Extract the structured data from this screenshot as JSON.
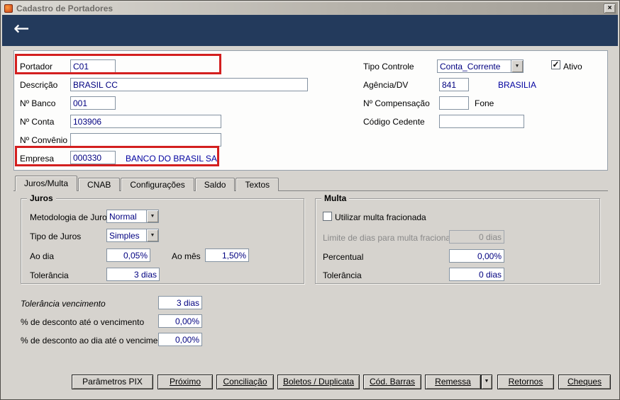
{
  "window": {
    "title": "Cadastro de Portadores",
    "close": "×"
  },
  "header": {
    "back_icon": "←"
  },
  "colors": {
    "header_bg": "#233a5c",
    "field_text": "#000080",
    "highlight_red": "#d31f1f",
    "info_blue": "#0000a0"
  },
  "form": {
    "portador": {
      "label": "Portador",
      "value": "C01"
    },
    "descricao": {
      "label": "Descrição",
      "value": "BRASIL CC"
    },
    "n_banco": {
      "label": "Nº Banco",
      "value": "001"
    },
    "n_conta": {
      "label": "Nº Conta",
      "value": "103906"
    },
    "n_convenio": {
      "label": "Nº Convênio",
      "value": ""
    },
    "empresa": {
      "label": "Empresa",
      "value": "000330",
      "descricao": "BANCO DO BRASIL SA"
    },
    "tipo_controle": {
      "label": "Tipo Controle",
      "value": "Conta_Corrente"
    },
    "ativo": {
      "label": "Ativo",
      "checked": true
    },
    "agencia_dv": {
      "label": "Agência/DV",
      "value": "841",
      "descricao": "BRASILIA"
    },
    "n_compensacao": {
      "label": "Nº Compensação",
      "value": "",
      "fone_label": "Fone"
    },
    "codigo_cedente": {
      "label": "Código Cedente",
      "value": ""
    }
  },
  "tabs": [
    {
      "label": "Juros/Multa",
      "active": true
    },
    {
      "label": "CNAB"
    },
    {
      "label": "Configurações"
    },
    {
      "label": "Saldo"
    },
    {
      "label": "Textos"
    }
  ],
  "juros": {
    "title": "Juros",
    "metodologia": {
      "label": "Metodologia de Juros",
      "value": "Normal"
    },
    "tipo": {
      "label": "Tipo de Juros",
      "value": "Simples"
    },
    "ao_dia": {
      "label": "Ao dia",
      "value": "0,05%"
    },
    "ao_mes": {
      "label": "Ao mês",
      "value": "1,50%"
    },
    "tolerancia": {
      "label": "Tolerância",
      "value": "3 dias"
    }
  },
  "multa": {
    "title": "Multa",
    "utilizar": {
      "label": "Utilizar multa fracionada",
      "checked": false
    },
    "limite": {
      "label": "Limite de dias para multa fracionada",
      "value": "0 dias"
    },
    "percentual": {
      "label": "Percentual",
      "value": "0,00%"
    },
    "tolerancia": {
      "label": "Tolerância",
      "value": "0 dias"
    }
  },
  "descontos": {
    "tolerancia_vencimento": {
      "label": "Tolerância vencimento",
      "value": "3 dias"
    },
    "desconto_ate": {
      "label": "% de desconto até o vencimento",
      "value": "0,00%"
    },
    "desconto_ao_dia": {
      "label": "% de desconto ao dia até o vencimento",
      "value": "0,00%"
    }
  },
  "footer": {
    "buttons": [
      {
        "label": "Parâmetros PIX"
      },
      {
        "label": "Próximo"
      },
      {
        "label": "Conciliação"
      },
      {
        "label": "Boletos / Duplicata"
      },
      {
        "label": "Cód. Barras"
      },
      {
        "label": "Remessa"
      },
      {
        "label": "Retornos"
      },
      {
        "label": "Cheques"
      }
    ]
  }
}
